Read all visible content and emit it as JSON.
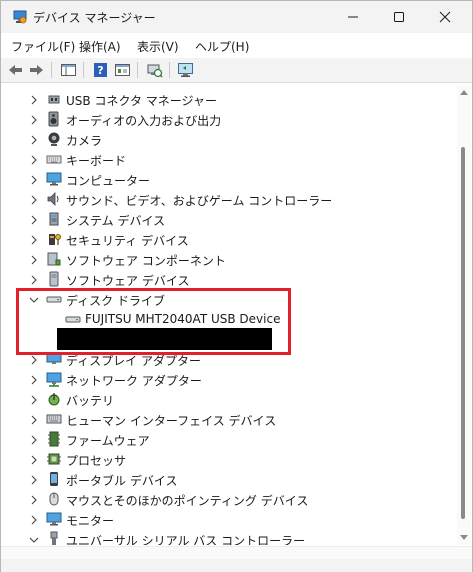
{
  "window": {
    "title": "デバイス マネージャー"
  },
  "menu": [
    {
      "label": "ファイル(F)"
    },
    {
      "label": "操作(A)"
    },
    {
      "label": "表示(V)"
    },
    {
      "label": "ヘルプ(H)"
    }
  ],
  "tree": {
    "items": [
      {
        "label": "USB コネクタ マネージャー",
        "icon": "usb-connector-icon",
        "expanded": false
      },
      {
        "label": "オーディオの入力および出力",
        "icon": "speaker-icon",
        "expanded": false
      },
      {
        "label": "カメラ",
        "icon": "camera-icon",
        "expanded": false
      },
      {
        "label": "キーボード",
        "icon": "keyboard-icon",
        "expanded": false
      },
      {
        "label": "コンピューター",
        "icon": "computer-icon",
        "expanded": false
      },
      {
        "label": "サウンド、ビデオ、およびゲーム コントローラー",
        "icon": "sound-video-icon",
        "expanded": false
      },
      {
        "label": "システム デバイス",
        "icon": "system-device-icon",
        "expanded": false
      },
      {
        "label": "セキュリティ デバイス",
        "icon": "security-device-icon",
        "expanded": false
      },
      {
        "label": "ソフトウェア コンポーネント",
        "icon": "software-component-icon",
        "expanded": false
      },
      {
        "label": "ソフトウェア デバイス",
        "icon": "software-device-icon",
        "expanded": false
      },
      {
        "label": "ディスク ドライブ",
        "icon": "disk-drive-icon",
        "expanded": true
      },
      {
        "label": "FUJITSU MHT2040AT USB Device",
        "icon": "disk-drive-icon",
        "child": true
      },
      {
        "label": "",
        "icon": "",
        "child": true,
        "redacted": true
      },
      {
        "label": "ディスプレイ アダプター",
        "icon": "display-adapter-icon",
        "expanded": false
      },
      {
        "label": "ネットワーク アダプター",
        "icon": "network-adapter-icon",
        "expanded": false
      },
      {
        "label": "バッテリ",
        "icon": "battery-icon",
        "expanded": false
      },
      {
        "label": "ヒューマン インターフェイス デバイス",
        "icon": "hid-icon",
        "expanded": false
      },
      {
        "label": "ファームウェア",
        "icon": "firmware-icon",
        "expanded": false
      },
      {
        "label": "プロセッサ",
        "icon": "processor-icon",
        "expanded": false
      },
      {
        "label": "ポータブル デバイス",
        "icon": "portable-device-icon",
        "expanded": false
      },
      {
        "label": "マウスとそのほかのポインティング デバイス",
        "icon": "mouse-icon",
        "expanded": false
      },
      {
        "label": "モニター",
        "icon": "monitor-icon",
        "expanded": false
      },
      {
        "label": "ユニバーサル シリアル バス コントローラー",
        "icon": "usb-controller-icon",
        "expanded": true
      }
    ]
  },
  "colors": {
    "highlight": "#e2202c",
    "accent": "#0067c0"
  }
}
